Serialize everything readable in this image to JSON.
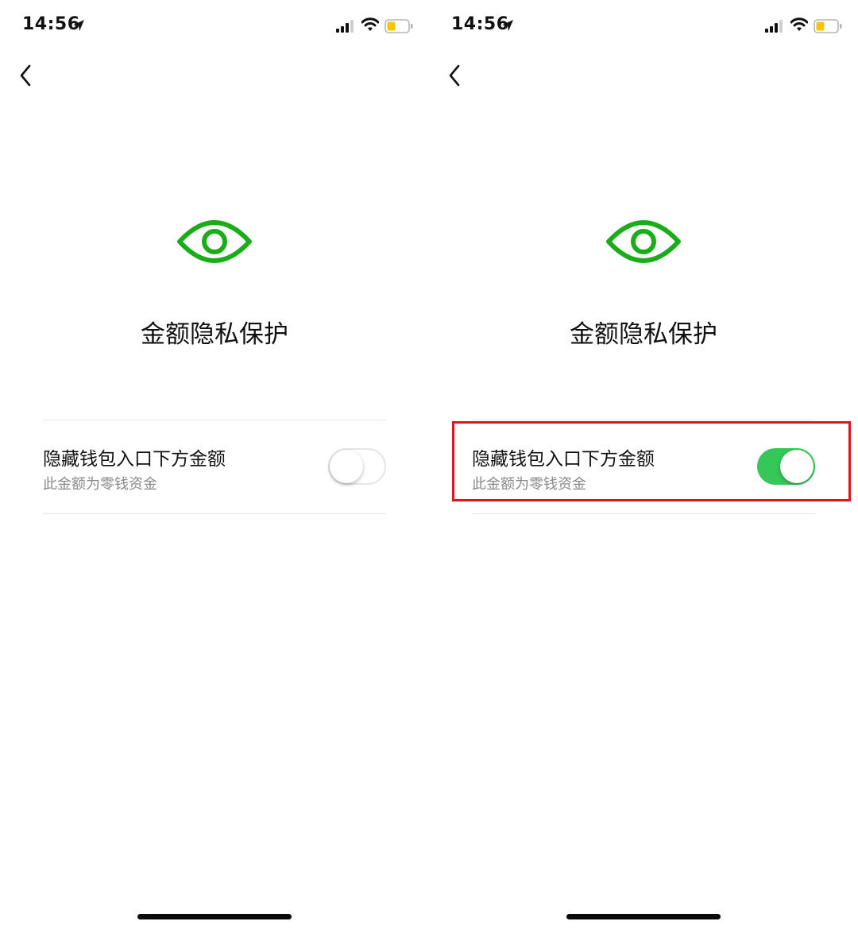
{
  "screens": [
    {
      "status_bar": {
        "time": "14:56"
      },
      "title": "金额隐私保护",
      "setting": {
        "title": "隐藏钱包入口下方金额",
        "subtitle": "此金额为零钱资金",
        "enabled": false
      },
      "highlighted": false
    },
    {
      "status_bar": {
        "time": "14:56"
      },
      "title": "金额隐私保护",
      "setting": {
        "title": "隐藏钱包入口下方金额",
        "subtitle": "此金额为零钱资金",
        "enabled": true
      },
      "highlighted": true
    }
  ],
  "colors": {
    "accent_green": "#1aad19",
    "toggle_on": "#35c758",
    "highlight_red": "#e0141e",
    "battery_yellow": "#f6c700"
  },
  "icons": [
    "location-arrow-icon",
    "signal-icon",
    "wifi-icon",
    "battery-icon",
    "back-chevron-icon",
    "eye-icon"
  ]
}
